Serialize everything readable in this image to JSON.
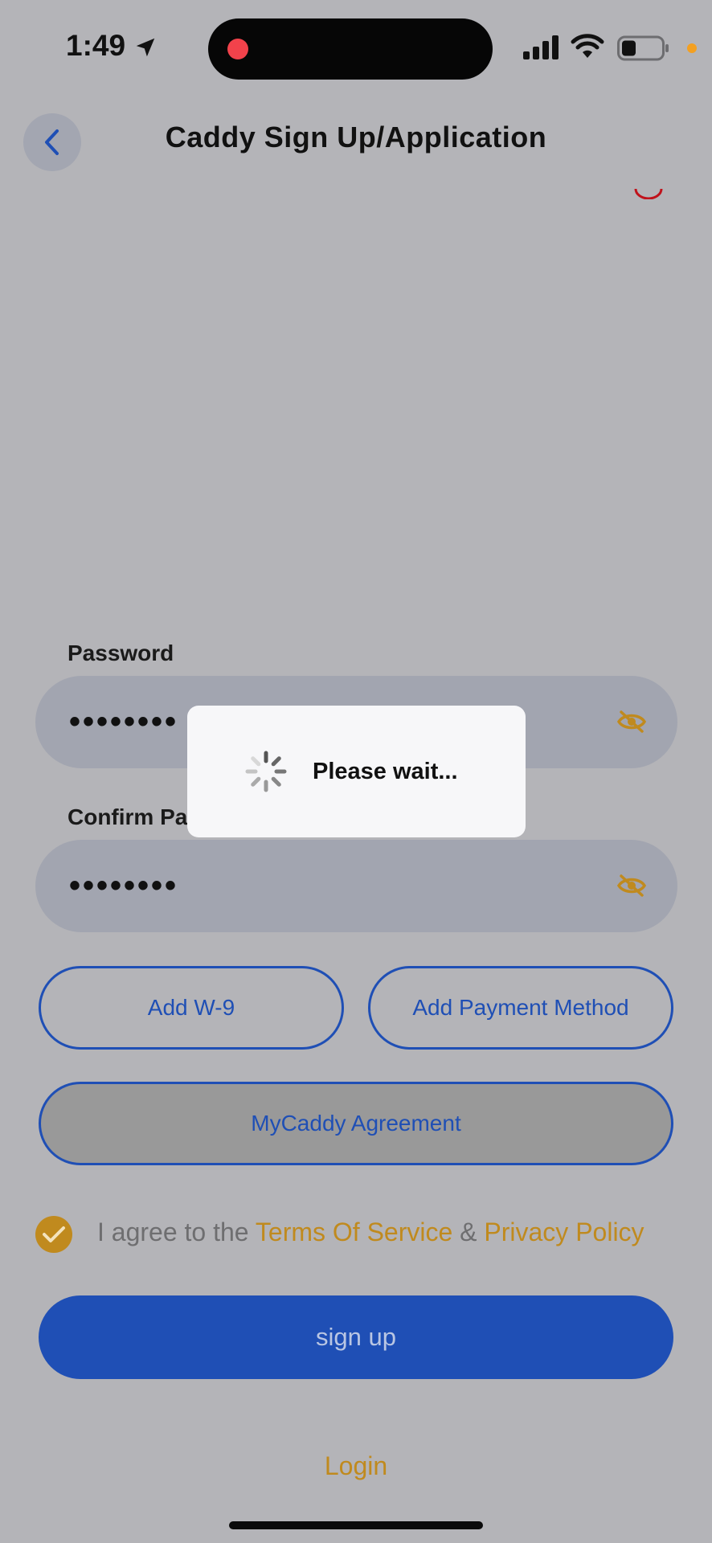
{
  "status_bar": {
    "time": "1:49"
  },
  "header": {
    "title": "Caddy Sign Up/Application"
  },
  "form": {
    "password": {
      "label": "Password",
      "value": "••••••••"
    },
    "confirm_password": {
      "label": "Confirm Pas",
      "value": "••••••••"
    },
    "buttons": {
      "add_w9": "Add W-9",
      "add_payment": "Add Payment Method",
      "agreement": "MyCaddy Agreement",
      "sign_up": "sign up"
    },
    "terms": {
      "prefix": "I agree to the ",
      "terms_link": "Terms Of Service",
      "amp": " & ",
      "privacy_link": "Privacy Policy",
      "checked": true
    },
    "login_link": "Login"
  },
  "loading_dialog": {
    "message": "Please wait..."
  },
  "colors": {
    "accent_blue": "#1f4fb5",
    "accent_gold": "#c08a1e",
    "backdrop": "#b4b4b8"
  },
  "icons": [
    "location-arrow-icon",
    "signal-icon",
    "wifi-icon",
    "battery-icon",
    "back-chevron-icon",
    "eye-slash-icon",
    "checkmark-icon",
    "spinner-icon"
  ]
}
